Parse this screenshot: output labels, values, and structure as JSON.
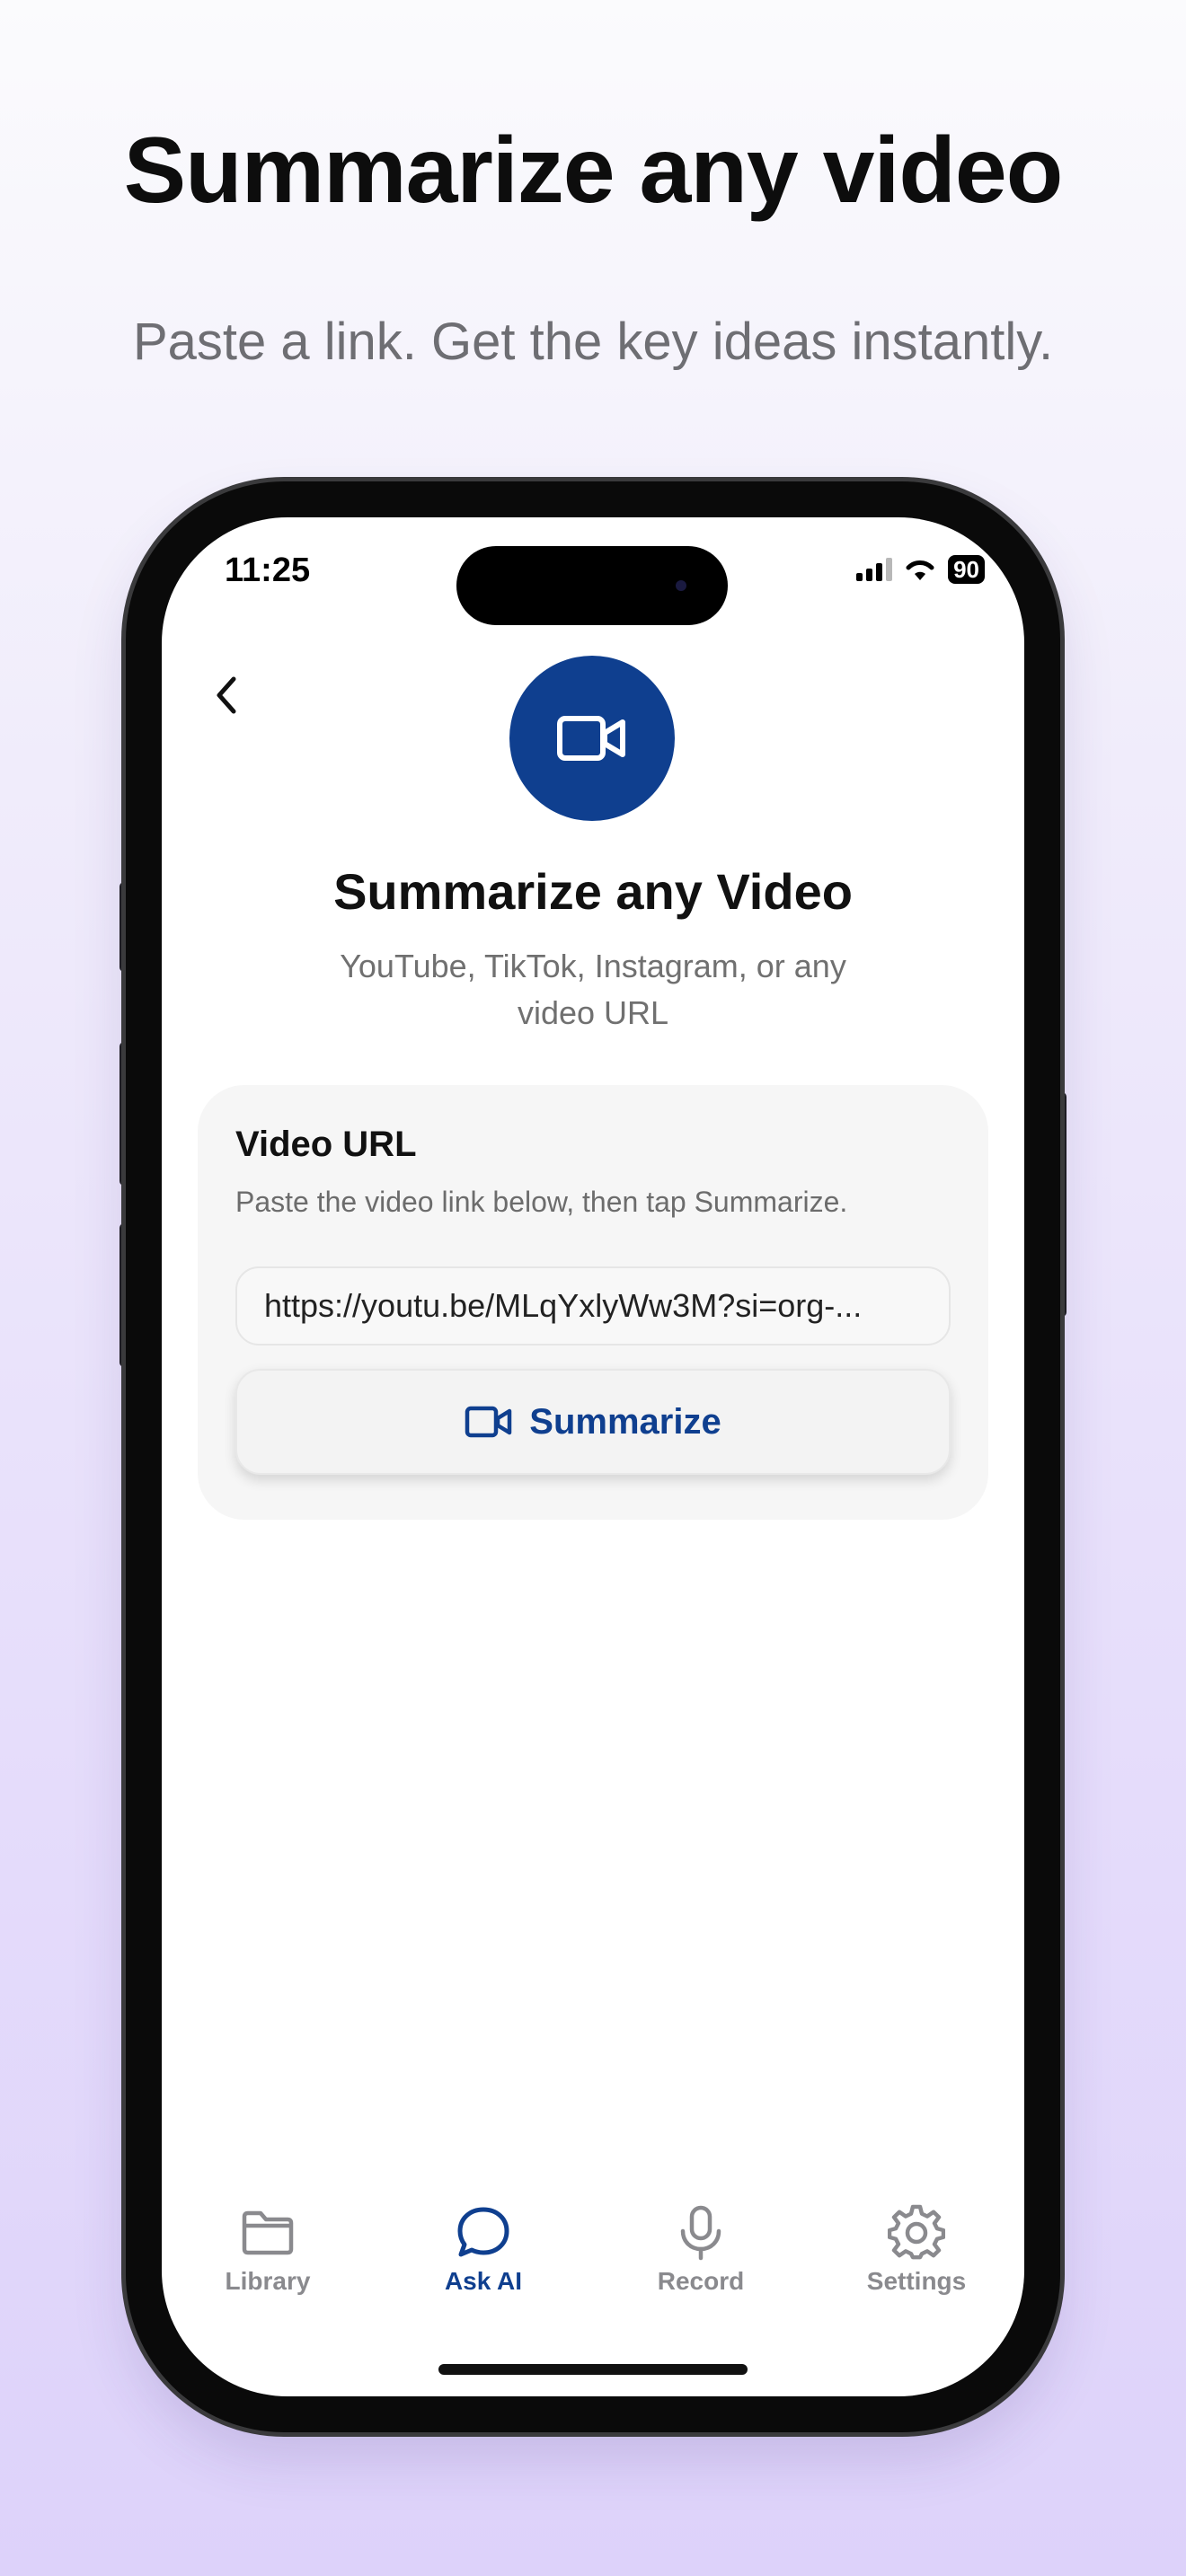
{
  "marketing": {
    "headline": "Summarize any video",
    "subheadline": "Paste a link. Get the key ideas instantly."
  },
  "status_bar": {
    "time": "11:25",
    "battery": "90"
  },
  "screen": {
    "title": "Summarize any Video",
    "subtitle": "YouTube, TikTok, Instagram, or any video URL"
  },
  "card": {
    "title": "Video URL",
    "help_text": "Paste the video link below, then tap Summarize.",
    "url_value": "https://youtu.be/MLqYxlyWw3M?si=org-...",
    "button_label": "Summarize"
  },
  "tabs": [
    {
      "label": "Library",
      "icon": "folder-icon",
      "active": false
    },
    {
      "label": "Ask AI",
      "icon": "chat-bubble-icon",
      "active": true
    },
    {
      "label": "Record",
      "icon": "microphone-icon",
      "active": false
    },
    {
      "label": "Settings",
      "icon": "gear-icon",
      "active": false
    }
  ],
  "colors": {
    "accent": "#0f3f8f",
    "inactive_tab": "#8a8a8e"
  }
}
